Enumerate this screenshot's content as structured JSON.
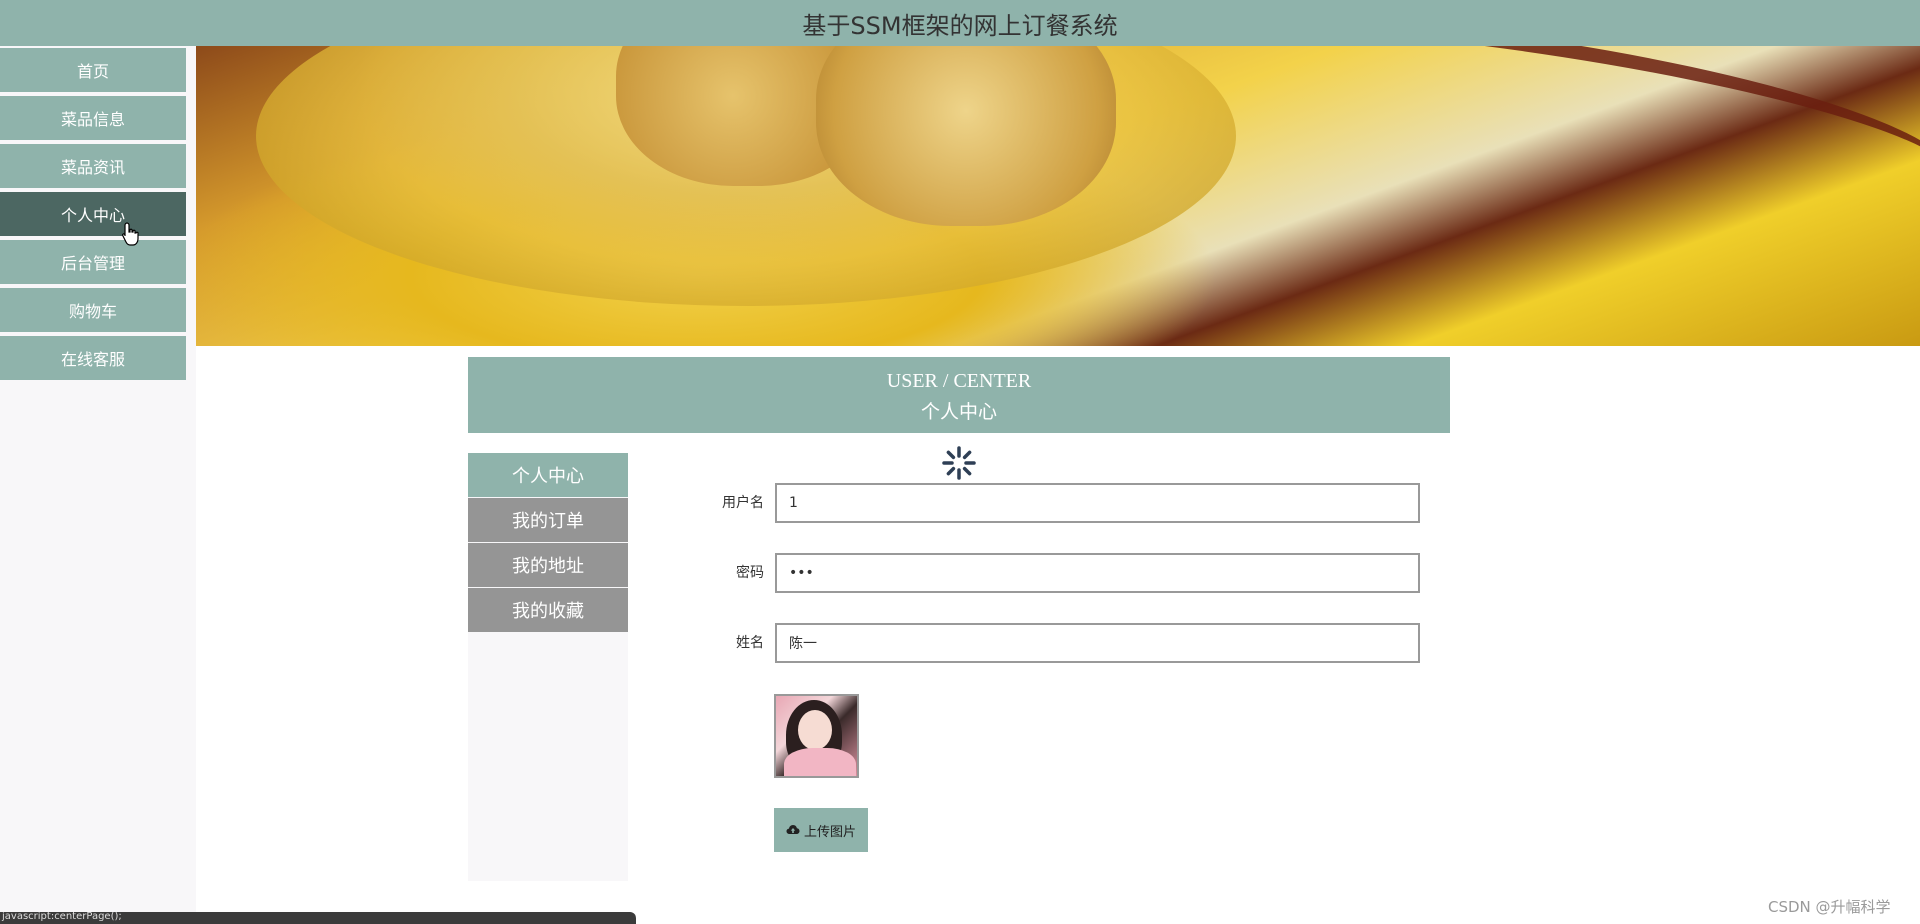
{
  "header": {
    "title": "基于SSM框架的网上订餐系统"
  },
  "nav": {
    "items": [
      {
        "label": "首页"
      },
      {
        "label": "菜品信息"
      },
      {
        "label": "菜品资讯"
      },
      {
        "label": "个人中心",
        "active": true
      },
      {
        "label": "后台管理"
      },
      {
        "label": "购物车"
      },
      {
        "label": "在线客服"
      }
    ]
  },
  "user_center": {
    "title_en": "USER / CENTER",
    "title_cn": "个人中心",
    "menu": [
      {
        "label": "个人中心",
        "active": true
      },
      {
        "label": "我的订单"
      },
      {
        "label": "我的地址"
      },
      {
        "label": "我的收藏"
      }
    ]
  },
  "form": {
    "username": {
      "label": "用户名",
      "value": "1"
    },
    "password": {
      "label": "密码",
      "value": "•••"
    },
    "name": {
      "label": "姓名",
      "value": "陈一"
    },
    "upload_label": "上传图片"
  },
  "status_bar": {
    "text": "javascript:centerPage();"
  },
  "watermark": "CSDN @升幅科学",
  "colors": {
    "primary": "#8fb3ab",
    "active_nav": "#4c6762",
    "sub_nav": "#959595"
  }
}
